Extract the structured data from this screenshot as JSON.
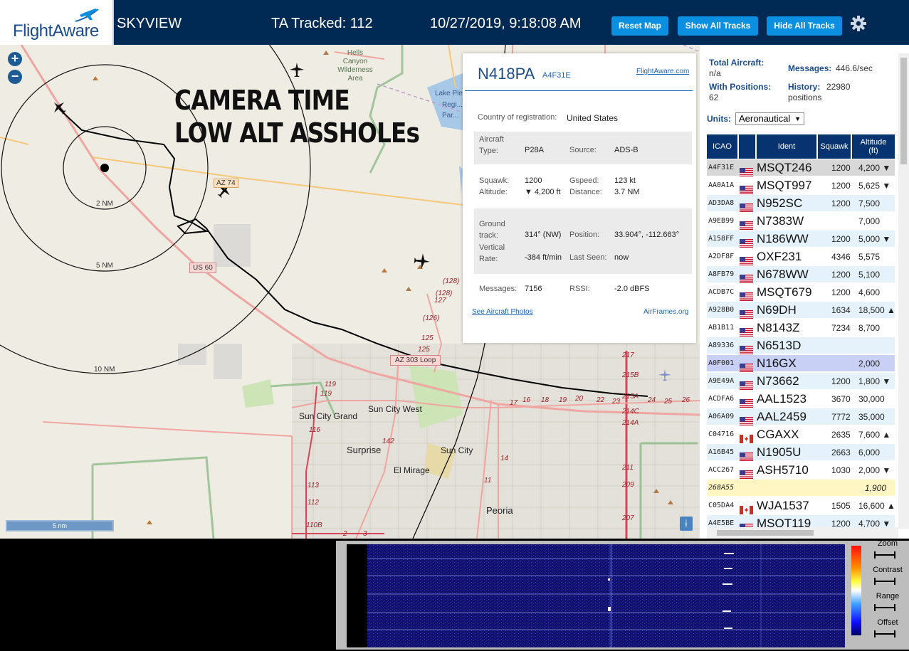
{
  "header": {
    "logo_text": "FlightAware",
    "app_name": "SKYVIEW",
    "tracked": "TA Tracked: 112",
    "datetime": "10/27/2019, 9:18:08 AM",
    "buttons": {
      "reset": "Reset Map",
      "show": "Show All Tracks",
      "hide": "Hide All Tracks"
    }
  },
  "map": {
    "overlay_line1": "CAMERA TIME",
    "overlay_line2": "LOW ALT ASSHOLEs",
    "zoom_in": "+",
    "zoom_out": "−",
    "scale_label": "5 nm",
    "info_button": "i",
    "range_rings": [
      "2 NM",
      "5 NM",
      "10 NM"
    ],
    "place_labels": [
      "Hells Canyon Wilderness Area",
      "Lake Ple...",
      "Regi...",
      "Par...",
      "Sun City Grand",
      "Sun City West",
      "Surprise",
      "Sun City",
      "El Mirage",
      "Peoria"
    ],
    "road_labels": [
      "AZ 74",
      "US 60",
      "AZ 303 Loop"
    ],
    "route_numbers": [
      "(128)",
      "(128)",
      "127",
      "(126)",
      "125",
      "125",
      "119",
      "119",
      "116",
      "113",
      "112",
      "110B",
      "142",
      "17",
      "16",
      "18",
      "19",
      "20",
      "22",
      "23",
      "24",
      "25",
      "26",
      "14",
      "11",
      "217",
      "215B",
      "215A",
      "214C",
      "214A",
      "211",
      "209",
      "207",
      "2",
      "3"
    ]
  },
  "popup": {
    "registration": "N418PA",
    "hex": "A4F31E",
    "link": "FlightAware.com",
    "country_label": "Country of registration:",
    "country": "United States",
    "aircraft_type_label": "Aircraft Type:",
    "aircraft_type": "P28A",
    "source_label": "Source:",
    "source": "ADS-B",
    "squawk_label": "Squawk:",
    "squawk": "1200",
    "gspeed_label": "Gspeed:",
    "gspeed": "123 kt",
    "altitude_label": "Altitude:",
    "altitude": "▼ 4,200 ft",
    "distance_label": "Distance:",
    "distance": "3.7 NM",
    "track_label": "Ground track:",
    "track": "314° (NW)",
    "position_label": "Position:",
    "position": "33.904°, -112.663°",
    "vrate_label": "Vertical Rate:",
    "vrate": "-384 ft/min",
    "lastseen_label": "Last Seen:",
    "lastseen": "now",
    "messages_label": "Messages:",
    "messages": "7156",
    "rssi_label": "RSSI:",
    "rssi": "-2.0 dBFS",
    "photos_link": "See Aircraft Photos",
    "airframes_link": "AirFrames.org"
  },
  "sidebar": {
    "total_label": "Total Aircraft:",
    "total_value": "n/a",
    "messages_label": "Messages:",
    "messages_value": "446.6/sec",
    "positions_label": "With Positions:",
    "positions_value": "62",
    "history_label": "History:",
    "history_value": "22980",
    "history_unit": "positions",
    "units_label": "Units:",
    "units_value": "Aeronautical",
    "columns": [
      "ICAO",
      "Ident",
      "Squawk",
      "Altitude (ft)"
    ],
    "rows": [
      {
        "icao": "A4F31E",
        "flag": "US",
        "ident": "MSQT246",
        "squawk": "1200",
        "alt": "4,200 ▼",
        "hl": "selected"
      },
      {
        "icao": "AA0A1A",
        "flag": "US",
        "ident": "MSQT997",
        "squawk": "1200",
        "alt": "5,625 ▼",
        "hl": ""
      },
      {
        "icao": "AD3DA8",
        "flag": "US",
        "ident": "N952SC",
        "squawk": "1200",
        "alt": "7,500",
        "hl": ""
      },
      {
        "icao": "A9EB99",
        "flag": "US",
        "ident": "N7383W",
        "squawk": "",
        "alt": "7,000",
        "hl": ""
      },
      {
        "icao": "A158FF",
        "flag": "US",
        "ident": "N186WW",
        "squawk": "1200",
        "alt": "5,000 ▼",
        "hl": ""
      },
      {
        "icao": "A2DF8F",
        "flag": "US",
        "ident": "OXF231",
        "squawk": "4346",
        "alt": "5,575",
        "hl": ""
      },
      {
        "icao": "A8FB79",
        "flag": "US",
        "ident": "N678WW",
        "squawk": "1200",
        "alt": "5,100",
        "hl": ""
      },
      {
        "icao": "ACDB7C",
        "flag": "US",
        "ident": "MSQT679",
        "squawk": "1200",
        "alt": "4,600",
        "hl": ""
      },
      {
        "icao": "A928B0",
        "flag": "US",
        "ident": "N69DH",
        "squawk": "1634",
        "alt": "18,500 ▲",
        "hl": ""
      },
      {
        "icao": "AB1B11",
        "flag": "US",
        "ident": "N8143Z",
        "squawk": "7234",
        "alt": "8,700",
        "hl": ""
      },
      {
        "icao": "A89336",
        "flag": "US",
        "ident": "N6513D",
        "squawk": "",
        "alt": "",
        "hl": ""
      },
      {
        "icao": "A0F001",
        "flag": "US",
        "ident": "N16GX",
        "squawk": "",
        "alt": "2,000",
        "hl": "hover"
      },
      {
        "icao": "A9E49A",
        "flag": "US",
        "ident": "N73662",
        "squawk": "1200",
        "alt": "1,800 ▼",
        "hl": ""
      },
      {
        "icao": "ACDFA6",
        "flag": "US",
        "ident": "AAL1523",
        "squawk": "3670",
        "alt": "30,000",
        "hl": ""
      },
      {
        "icao": "A06A09",
        "flag": "US",
        "ident": "AAL2459",
        "squawk": "7772",
        "alt": "35,000",
        "hl": ""
      },
      {
        "icao": "C04716",
        "flag": "CA",
        "ident": "CGAXX",
        "squawk": "2635",
        "alt": "7,600 ▲",
        "hl": ""
      },
      {
        "icao": "A16B45",
        "flag": "US",
        "ident": "N1905U",
        "squawk": "2663",
        "alt": "6,000",
        "hl": ""
      },
      {
        "icao": "ACC267",
        "flag": "US",
        "ident": "ASH5710",
        "squawk": "1030",
        "alt": "2,000 ▼",
        "hl": ""
      },
      {
        "icao": "268A55",
        "flag": "",
        "ident": "",
        "squawk": "",
        "alt": "1,900",
        "hl": "mlat"
      },
      {
        "icao": "C05DA4",
        "flag": "CA",
        "ident": "WJA1537",
        "squawk": "1505",
        "alt": "16,600 ▲",
        "hl": ""
      },
      {
        "icao": "A4E5BE",
        "flag": "US",
        "ident": "MSQT119",
        "squawk": "1200",
        "alt": "4,700 ▼",
        "hl": ""
      }
    ]
  },
  "waterfall": {
    "zoom_label": "Zoom",
    "contrast_label": "Contrast",
    "range_label": "Range",
    "offset_label": "Offset"
  },
  "colors": {
    "header_bg": "#002a53",
    "button": "#0b8fe0",
    "table_head": "#073470",
    "row_alt": "#e6f2fb",
    "row_selected": "#d8d8d8",
    "row_hover": "#c9d0f5",
    "row_mlat": "#fff6c3",
    "track": "#000000"
  }
}
